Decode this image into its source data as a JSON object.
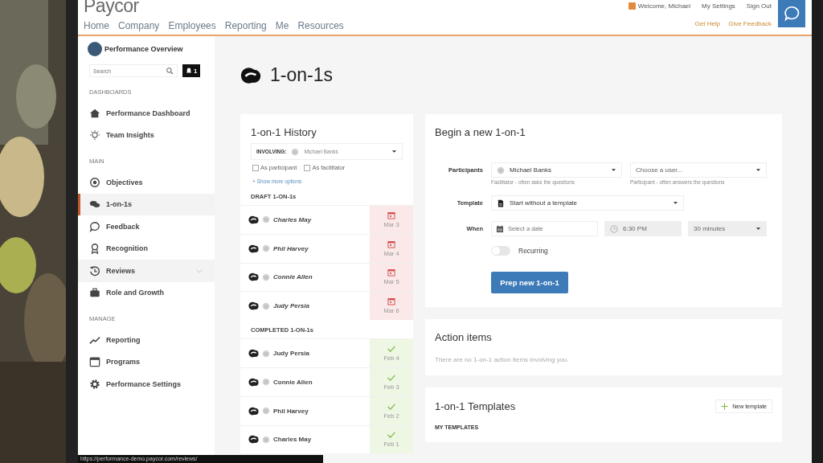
{
  "logo": "Paycor",
  "nav": [
    "Home",
    "Company",
    "Employees",
    "Reporting",
    "Me",
    "Resources"
  ],
  "user_links": [
    "Welcome, Michael",
    "My Settings",
    "Sign Out"
  ],
  "help_links": [
    "Get Help",
    "Give Feedback"
  ],
  "sidebar": {
    "title": "Performance Overview",
    "search_placeholder": "Search",
    "notification_count": "1",
    "sections": [
      {
        "heading": "DASHBOARDS",
        "items": [
          {
            "label": "Performance Dashboard",
            "selected": false,
            "hovered": false,
            "expandable": false
          },
          {
            "label": "Team Insights",
            "selected": false,
            "hovered": false,
            "expandable": false
          }
        ]
      },
      {
        "heading": "MAIN",
        "items": [
          {
            "label": "Objectives",
            "selected": false,
            "hovered": false,
            "expandable": false
          },
          {
            "label": "1-on-1s",
            "selected": true,
            "hovered": false,
            "expandable": false
          },
          {
            "label": "Feedback",
            "selected": false,
            "hovered": false,
            "expandable": false
          },
          {
            "label": "Recognition",
            "selected": false,
            "hovered": false,
            "expandable": false
          },
          {
            "label": "Reviews",
            "selected": false,
            "hovered": true,
            "expandable": true
          },
          {
            "label": "Role and Growth",
            "selected": false,
            "hovered": false,
            "expandable": false
          }
        ]
      },
      {
        "heading": "MANAGE",
        "items": [
          {
            "label": "Reporting",
            "selected": false,
            "hovered": false,
            "expandable": false
          },
          {
            "label": "Programs",
            "selected": false,
            "hovered": false,
            "expandable": false
          },
          {
            "label": "Performance Settings",
            "selected": false,
            "hovered": false,
            "expandable": false
          }
        ]
      }
    ]
  },
  "page_title": "1-on-1s",
  "history": {
    "title": "1-on-1 History",
    "filter_label": "INVOLVING:",
    "filter_value": "Michael Banks",
    "checkboxes": [
      {
        "label": "As participant",
        "checked": false
      },
      {
        "label": "As facilitator",
        "checked": false
      }
    ],
    "more_link": "+ Show more options",
    "groups": [
      {
        "heading": "DRAFT 1-ON-1s",
        "kind": "draft",
        "rows": [
          {
            "name": "Charles May",
            "date": "Mar 3"
          },
          {
            "name": "Phil Harvey",
            "date": "Mar 4"
          },
          {
            "name": "Connie Allen",
            "date": "Mar 5"
          },
          {
            "name": "Judy Persia",
            "date": "Mar 6"
          }
        ]
      },
      {
        "heading": "COMPLETED 1-ON-1s",
        "kind": "completed",
        "rows": [
          {
            "name": "Judy Persia",
            "date": "Feb 4"
          },
          {
            "name": "Connie Allen",
            "date": "Feb 3"
          },
          {
            "name": "Phil Harvey",
            "date": "Feb 2"
          },
          {
            "name": "Charles May",
            "date": "Feb 1"
          }
        ]
      }
    ]
  },
  "new_form": {
    "title": "Begin a new 1-on-1",
    "participants_label": "Participants",
    "facilitator_value": "Michael Banks",
    "facilitator_hint": "Facilitator - often asks the questions",
    "participant_placeholder": "Choose a user...",
    "participant_hint": "Participant - often answers the questions",
    "template_label": "Template",
    "template_value": "Start without a template",
    "when_label": "When",
    "date_placeholder": "Select a date",
    "time_value": "6:30 PM",
    "duration_value": "30 minutes",
    "recurring_label": "Recurring",
    "recurring_on": false,
    "submit": "Prep new 1-on-1"
  },
  "action_items": {
    "title": "Action items",
    "empty_text": "There are no 1-on-1 action items involving you."
  },
  "templates": {
    "title": "1-on-1 Templates",
    "new_button": "New template",
    "section_heading": "MY TEMPLATES"
  },
  "status_url": "https://performance-demo.paycor.com/reviews/"
}
